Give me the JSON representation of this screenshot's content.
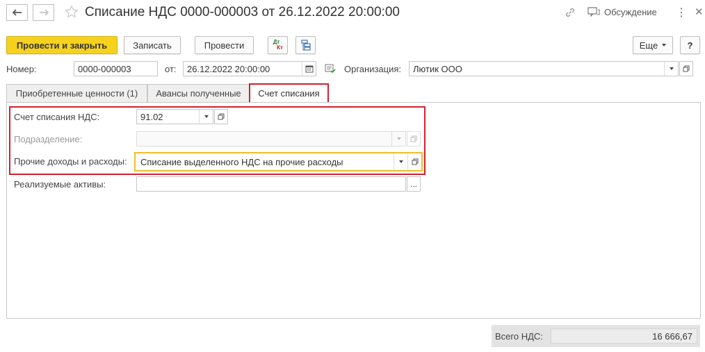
{
  "header": {
    "title": "Списание НДС 0000-000003 от 26.12.2022 20:00:00",
    "discussion_label": "Обсуждение"
  },
  "toolbar": {
    "post_close_label": "Провести и закрыть",
    "save_label": "Записать",
    "post_label": "Провести",
    "dtkt_label_top": "Дт",
    "dtkt_label_bottom": "Кт",
    "more_label": "Еще",
    "help_label": "?"
  },
  "form": {
    "number_label": "Номер:",
    "number_value": "0000-000003",
    "date_label": "от:",
    "date_value": "26.12.2022 20:00:00",
    "org_label": "Организация:",
    "org_value": "Лютик ООО"
  },
  "tabs": [
    {
      "label": "Приобретенные ценности (1)"
    },
    {
      "label": "Авансы полученные"
    },
    {
      "label": "Счет списания"
    }
  ],
  "writeoff": {
    "vat_account_label": "Счет списания НДС:",
    "vat_account_value": "91.02",
    "division_label": "Подразделение:",
    "division_value": "",
    "other_label": "Прочие доходы и расходы:",
    "other_value": "Списание выделенного НДС на прочие расходы",
    "assets_label": "Реализуемые активы:",
    "assets_value": "",
    "assets_button": "..."
  },
  "footer": {
    "total_vat_label": "Всего НДС:",
    "total_vat_value": "16 666,67"
  },
  "colors": {
    "accent_yellow": "#f6d21f",
    "highlight_red": "#d0202f",
    "focus_yellow": "#f0bd29"
  }
}
